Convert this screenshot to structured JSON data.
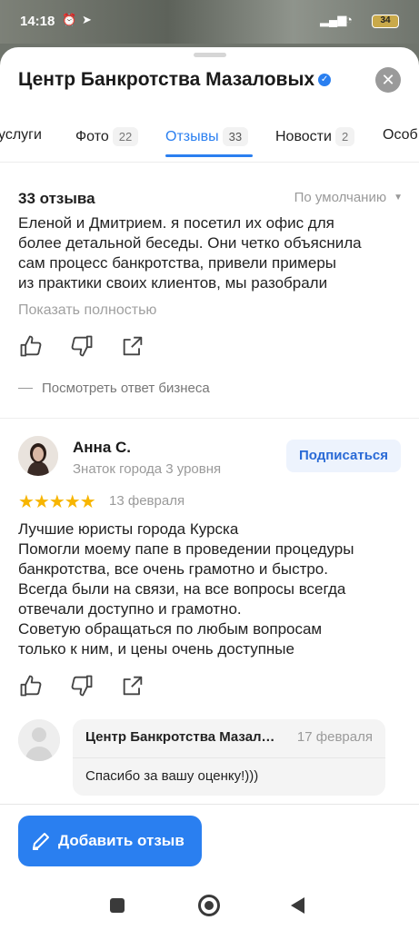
{
  "status_bar": {
    "time": "14:18",
    "battery": "34"
  },
  "header": {
    "title": "Центр Банкротства Мазаловых",
    "verified_mark": "✓",
    "close_label": "✕"
  },
  "tabs": [
    {
      "label": "услуги",
      "count": ""
    },
    {
      "label": "Фото",
      "count": "22"
    },
    {
      "label": "Отзывы",
      "count": "33"
    },
    {
      "label": "Новости",
      "count": "2"
    },
    {
      "label": "Особ",
      "count": ""
    }
  ],
  "reviews": {
    "count_label": "33 отзыва",
    "sort_label": "По умолчанию",
    "first_review": {
      "text": "Еленой и Дмитрием.  я посетил их офис для\nболее детальной беседы. Они четко объяснила\nсам процесс банкротства, привели примеры\nиз практики своих клиентов, мы разобрали",
      "show_more": "Показать полностью",
      "business_reply_link": "Посмотреть ответ бизнеса"
    },
    "second_review": {
      "author": "Анна С.",
      "level": "Знаток города 3 уровня",
      "subscribe_label": "Подписаться",
      "stars": "★★★★★",
      "rating": 5,
      "date": "13 февраля",
      "text": "Лучшие юристы города Курска\nПомогли моему папе в проведении процедуры\nбанкротства, все очень грамотно и быстро.\nВсегда были на связи, на все вопросы всегда\nотвечали доступно и грамотно.\nСоветую обращаться по любым вопросам\nтолько к ним, и цены очень доступные",
      "reply": {
        "name": "Центр Банкротства Мазаловых",
        "date": "17 февраля",
        "text": "Спасибо за вашу оценку!)))"
      }
    }
  },
  "add_review_label": "Добавить отзыв",
  "colors": {
    "accent": "#2a7ff0",
    "stars": "#f7b500"
  }
}
